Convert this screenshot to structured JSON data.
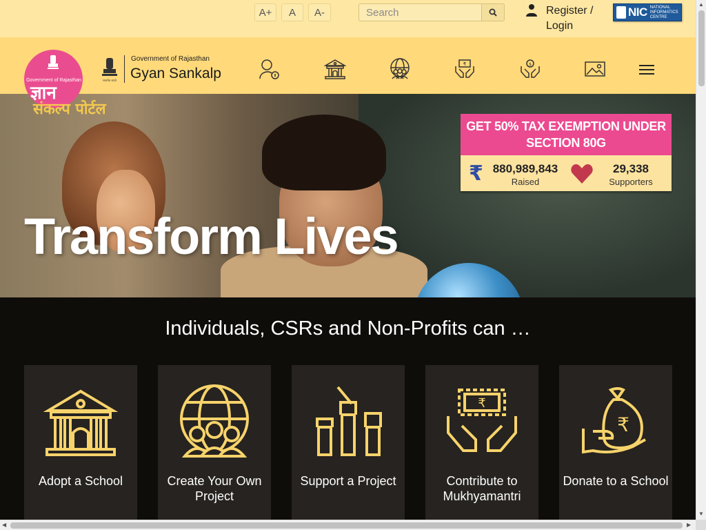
{
  "topbar": {
    "font_increase": "A+",
    "font_normal": "A",
    "font_decrease": "A-",
    "search_placeholder": "Search",
    "login_label": "Register / Login",
    "nic_label": "NIC",
    "nic_sub": "NATIONAL INFORMATICS CENTRE"
  },
  "brand": {
    "logo_gov_text": "Government of Rajasthan",
    "logo_hindi_1": "ज्ञान",
    "logo_hindi_2": "संकल्प पोर्टल",
    "small": "Government of Rajasthan",
    "big": "Gyan Sankalp"
  },
  "nav": {
    "icons": [
      "info-person-icon",
      "school-building-icon",
      "globe-people-icon",
      "rupee-hands-icon",
      "donate-hands-icon",
      "gallery-icon"
    ],
    "menu_icon": "hamburger-icon"
  },
  "hero": {
    "title": "Transform Lives",
    "tax_banner": "GET 50% TAX EXEMPTION UNDER SECTION 80G",
    "raised_value": "880,989,843",
    "raised_label": "Raised",
    "supporters_value": "29,338",
    "supporters_label": "Supporters",
    "rupee_symbol": "₹"
  },
  "section": {
    "title": "Individuals, CSRs and Non-Profits can …",
    "cards": [
      {
        "label": "Adopt a School",
        "icon": "school-icon"
      },
      {
        "label": "Create Your Own Project",
        "icon": "globe-people-icon"
      },
      {
        "label": "Support a Project",
        "icon": "raised-hands-icon"
      },
      {
        "label": "Contribute to Mukhyamantri",
        "icon": "rupee-note-hands-icon"
      },
      {
        "label": "Donate to a School",
        "icon": "money-bag-hand-icon"
      }
    ]
  },
  "colors": {
    "topbar_bg": "#fde7a3",
    "navbar_bg": "#ffd97a",
    "pink": "#ec4a90",
    "gold_icon": "#f7d36b",
    "card_bg": "#262320"
  }
}
